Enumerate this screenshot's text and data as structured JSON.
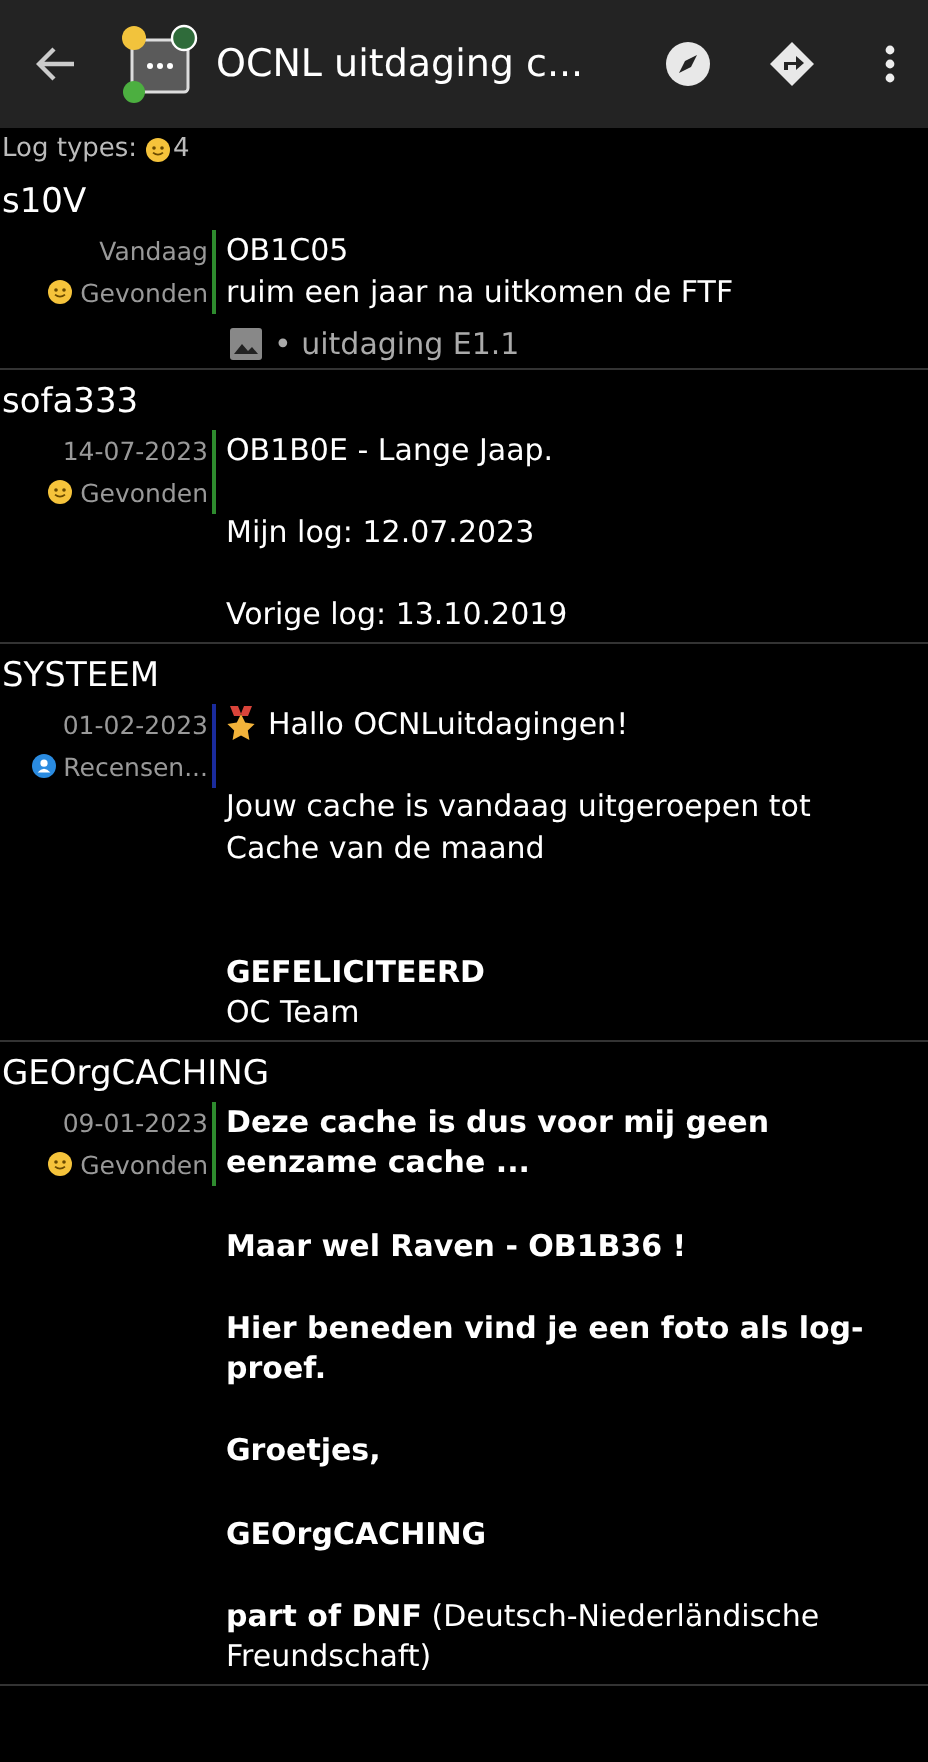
{
  "header": {
    "title": "OCNL uitdaging c..."
  },
  "log_types": {
    "label": "Log types:",
    "count": "4"
  },
  "logs": [
    {
      "author": "s10V",
      "date": "Vandaag",
      "type": {
        "kind": "found",
        "label": "Gevonden"
      },
      "body": "OB1C05\nruim een jaar na uitkomen de FTF",
      "attachment": "• uitdaging E1.1"
    },
    {
      "author": "sofa333",
      "date": "14-07-2023",
      "type": {
        "kind": "found",
        "label": "Gevonden"
      },
      "body": "OB1B0E - Lange Jaap.\n\nMijn log: 12.07.2023\n\nVorige log: 13.10.2019"
    },
    {
      "author": "SYSTEEM",
      "date": "01-02-2023",
      "type": {
        "kind": "reviewer",
        "label": "Recensen..."
      },
      "kind": "award",
      "body": "Hallo OCNLuitdagingen!\n\nJouw cache is vandaag uitgeroepen tot Cache van de maand\n\n\n**GEFELICITEERD**\nOC Team"
    },
    {
      "author": "GEOrgCACHING",
      "date": "09-01-2023",
      "type": {
        "kind": "found",
        "label": "Gevonden"
      },
      "body": "**Deze cache is dus voor mij geen eenzame cache ...**\n\n**Maar wel Raven - OB1B36 !**\n\n**Hier beneden vind je een foto als log-proef.**\n\n**Groetjes,**\n\n**GEOrgCACHING**\n\n**part of DNF**  (Deutsch-Niederländische Freundschaft)"
    }
  ]
}
